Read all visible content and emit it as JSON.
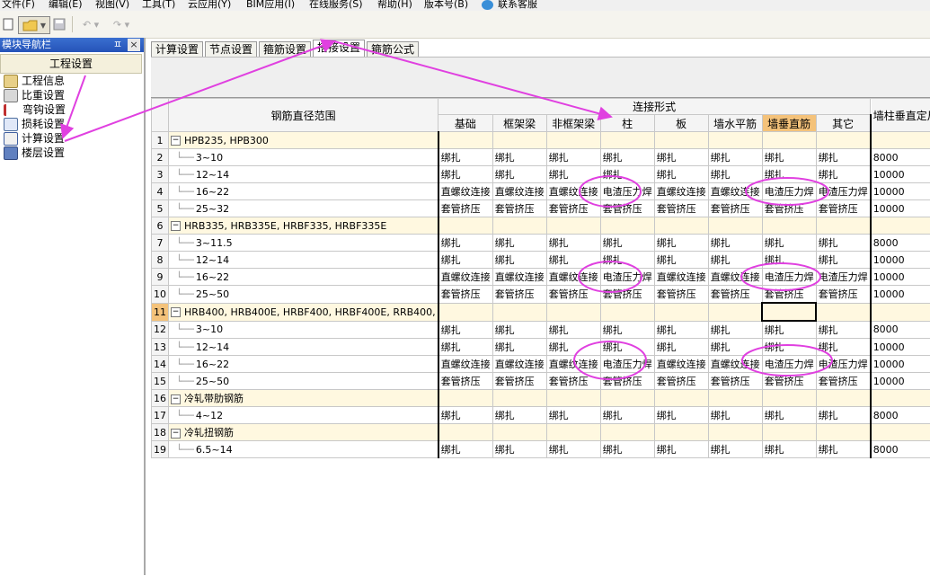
{
  "menu": [
    "文件(F)",
    "编辑(E)",
    "视图(V)",
    "工具(T)",
    "云应用(Y)",
    "BIM应用(I)",
    "在线服务(S)",
    "帮助(H)",
    "版本号(B)",
    "联系客服"
  ],
  "left_panel": {
    "title": "模块导航栏",
    "pin": "ㅍ",
    "close": "×",
    "section": "工程设置",
    "items": [
      "工程信息",
      "比重设置",
      "弯钩设置",
      "损耗设置",
      "计算设置",
      "楼层设置"
    ]
  },
  "tabs": [
    "计算设置",
    "节点设置",
    "箍筋设置",
    "搭接设置",
    "箍筋公式"
  ],
  "active_tab": "搭接设置",
  "grid": {
    "header_range": "钢筋直径范围",
    "header_group": "连接形式",
    "header_last": "墙柱垂直定尺",
    "columns": [
      "基础",
      "框架梁",
      "非框架梁",
      "柱",
      "板",
      "墙水平筋",
      "墙垂直筋",
      "其它"
    ],
    "rows": [
      {
        "n": "1",
        "group": true,
        "label": "HPB235, HPB300",
        "cells": []
      },
      {
        "n": "2",
        "label": "3~10",
        "cells": [
          "绑扎",
          "绑扎",
          "绑扎",
          "绑扎",
          "绑扎",
          "绑扎",
          "绑扎",
          "绑扎"
        ],
        "last": "8000"
      },
      {
        "n": "3",
        "label": "12~14",
        "cells": [
          "绑扎",
          "绑扎",
          "绑扎",
          "绑扎",
          "绑扎",
          "绑扎",
          "绑扎",
          "绑扎"
        ],
        "last": "10000"
      },
      {
        "n": "4",
        "label": "16~22",
        "cells": [
          "直螺纹连接",
          "直螺纹连接",
          "直螺纹连接",
          "电渣压力焊",
          "直螺纹连接",
          "直螺纹连接",
          "电渣压力焊",
          "电渣压力焊"
        ],
        "last": "10000"
      },
      {
        "n": "5",
        "label": "25~32",
        "cells": [
          "套管挤压",
          "套管挤压",
          "套管挤压",
          "套管挤压",
          "套管挤压",
          "套管挤压",
          "套管挤压",
          "套管挤压"
        ],
        "last": "10000"
      },
      {
        "n": "6",
        "group": true,
        "label": "HRB335, HRB335E, HRBF335, HRBF335E",
        "cells": []
      },
      {
        "n": "7",
        "label": "3~11.5",
        "cells": [
          "绑扎",
          "绑扎",
          "绑扎",
          "绑扎",
          "绑扎",
          "绑扎",
          "绑扎",
          "绑扎"
        ],
        "last": "8000"
      },
      {
        "n": "8",
        "label": "12~14",
        "cells": [
          "绑扎",
          "绑扎",
          "绑扎",
          "绑扎",
          "绑扎",
          "绑扎",
          "绑扎",
          "绑扎"
        ],
        "last": "10000"
      },
      {
        "n": "9",
        "label": "16~22",
        "cells": [
          "直螺纹连接",
          "直螺纹连接",
          "直螺纹连接",
          "电渣压力焊",
          "直螺纹连接",
          "直螺纹连接",
          "电渣压力焊",
          "电渣压力焊"
        ],
        "last": "10000"
      },
      {
        "n": "10",
        "label": "25~50",
        "cells": [
          "套管挤压",
          "套管挤压",
          "套管挤压",
          "套管挤压",
          "套管挤压",
          "套管挤压",
          "套管挤压",
          "套管挤压"
        ],
        "last": "10000"
      },
      {
        "n": "11",
        "group": true,
        "selected": true,
        "label": "HRB400, HRB400E, HRBF400, HRBF400E, RRB400,",
        "cells": []
      },
      {
        "n": "12",
        "label": "3~10",
        "cells": [
          "绑扎",
          "绑扎",
          "绑扎",
          "绑扎",
          "绑扎",
          "绑扎",
          "绑扎",
          "绑扎"
        ],
        "last": "8000"
      },
      {
        "n": "13",
        "label": "12~14",
        "cells": [
          "绑扎",
          "绑扎",
          "绑扎",
          "绑扎",
          "绑扎",
          "绑扎",
          "绑扎",
          "绑扎"
        ],
        "last": "10000"
      },
      {
        "n": "14",
        "label": "16~22",
        "cells": [
          "直螺纹连接",
          "直螺纹连接",
          "直螺纹连接",
          "电渣压力焊",
          "直螺纹连接",
          "直螺纹连接",
          "电渣压力焊",
          "电渣压力焊"
        ],
        "last": "10000"
      },
      {
        "n": "15",
        "label": "25~50",
        "cells": [
          "套管挤压",
          "套管挤压",
          "套管挤压",
          "套管挤压",
          "套管挤压",
          "套管挤压",
          "套管挤压",
          "套管挤压"
        ],
        "last": "10000"
      },
      {
        "n": "16",
        "group": true,
        "label": "冷轧带肋钢筋",
        "cells": []
      },
      {
        "n": "17",
        "label": "4~12",
        "cells": [
          "绑扎",
          "绑扎",
          "绑扎",
          "绑扎",
          "绑扎",
          "绑扎",
          "绑扎",
          "绑扎"
        ],
        "last": "8000"
      },
      {
        "n": "18",
        "group": true,
        "label": "冷轧扭钢筋",
        "cells": []
      },
      {
        "n": "19",
        "label": "6.5~14",
        "cells": [
          "绑扎",
          "绑扎",
          "绑扎",
          "绑扎",
          "绑扎",
          "绑扎",
          "绑扎",
          "绑扎"
        ],
        "last": "8000"
      }
    ]
  },
  "colors": {
    "annotation": "#e040e0",
    "highlight_header": "#f4c27a",
    "group_row": "#fff8e0",
    "nav_title": "#2553b8"
  }
}
